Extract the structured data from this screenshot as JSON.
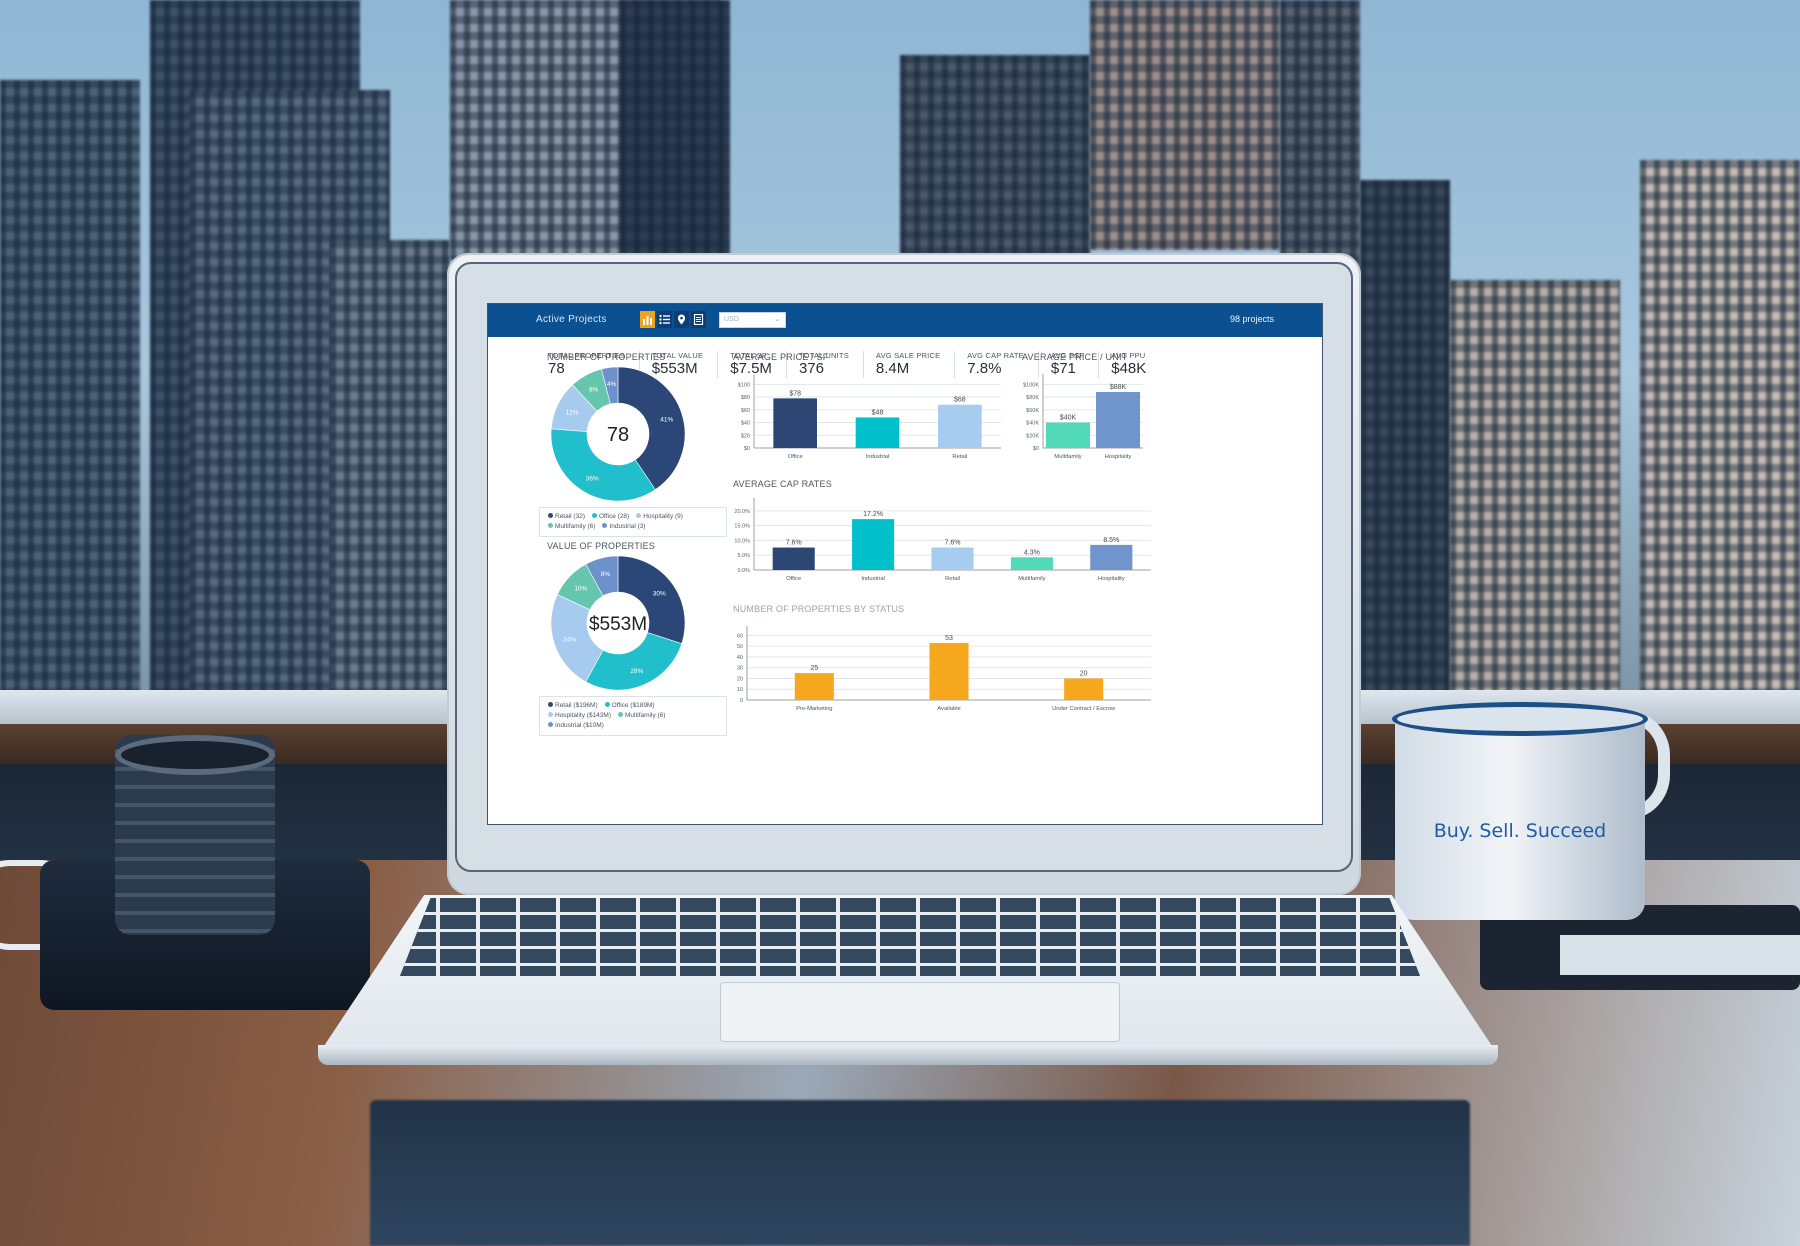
{
  "scene": {
    "mug_text": "Buy. Sell. Succeed"
  },
  "header": {
    "title": "Active Projects",
    "view_icons": [
      {
        "name": "bar-chart-icon",
        "active": true
      },
      {
        "name": "list-icon",
        "active": false
      },
      {
        "name": "map-pin-icon",
        "active": false
      },
      {
        "name": "document-icon",
        "active": false
      }
    ],
    "currency": {
      "value": "USD",
      "options_visible": [
        "USD"
      ]
    },
    "project_count": "98 projects"
  },
  "kpis": [
    {
      "label": "TOTAL PROPERTIES",
      "value": "78"
    },
    {
      "label": "TOTAL VALUE",
      "value": "$553M"
    },
    {
      "label": "TOTAL SF",
      "value": "$7.5M"
    },
    {
      "label": "TOTAL UNITS",
      "value": "376"
    },
    {
      "label": "AVG SALE PRICE",
      "value": "8.4M"
    },
    {
      "label": "AVG CAP RATE",
      "value": "7.8%"
    },
    {
      "label": "AVG PSF",
      "value": "$71"
    },
    {
      "label": "AVG PPU",
      "value": "$48K"
    }
  ],
  "colors": {
    "header_bg": "#0b5191",
    "active_icon": "#f4a21c",
    "retail": "#2b4777",
    "office": "#20bfcb",
    "hospitality": "#a6cbee",
    "multifamily": "#66c6ad",
    "industrial": "#6d91cb",
    "industrial_bar": "#00c0cc",
    "multifamily_bar": "#52d9b7",
    "hospitality_bar": "#6f95cc",
    "status_bar": "#f5a81e"
  },
  "chart_data": [
    {
      "id": "number_of_properties",
      "type": "pie",
      "title": "NUMBER OF PROPERTIES",
      "center_label": "78",
      "slices": [
        {
          "label": "Retail",
          "count": 32,
          "percent": 41,
          "color": "#2b4777"
        },
        {
          "label": "Office",
          "count": 28,
          "percent": 36,
          "color": "#20bfcb"
        },
        {
          "label": "Hospitality",
          "count": 9,
          "percent": 12,
          "color": "#a6cbee"
        },
        {
          "label": "Multifamily",
          "count": 6,
          "percent": 8,
          "color": "#66c6ad"
        },
        {
          "label": "Industrial",
          "count": 3,
          "percent": 4,
          "color": "#6d91cb"
        }
      ],
      "legend": [
        "Retail (32)",
        "Office (28)",
        "Hospitality (9)",
        "Multifamily (6)",
        "Industrial (3)"
      ],
      "legend_position": "bottom"
    },
    {
      "id": "value_of_properties",
      "type": "pie",
      "title": "VALUE OF PROPERTIES",
      "center_label": "$553M",
      "slices": [
        {
          "label": "Retail",
          "value_m": 196,
          "percent": 30,
          "color": "#2b4777"
        },
        {
          "label": "Office",
          "value_m": 189,
          "percent": 28,
          "color": "#20bfcb"
        },
        {
          "label": "Hospitality",
          "value_m": 143,
          "percent": 24,
          "color": "#a6cbee"
        },
        {
          "label": "Multifamily",
          "percent": 10,
          "color": "#66c6ad"
        },
        {
          "label": "Industrial",
          "value_m": 10,
          "percent": 8,
          "color": "#6d91cb"
        }
      ],
      "legend": [
        "Retail ($196M)",
        "Office ($189M)",
        "Hospitality ($143M)",
        "Multifamily (6)",
        "Industrial ($10M)"
      ],
      "legend_position": "bottom"
    },
    {
      "id": "avg_price_sf",
      "type": "bar",
      "title": "AVERAGE PRICE / SF",
      "categories": [
        "Office",
        "Industrial",
        "Retail"
      ],
      "values": [
        78,
        48,
        68
      ],
      "value_labels": [
        "$78",
        "$48",
        "$68"
      ],
      "colors": [
        "#2e4674",
        "#00c0cc",
        "#a6cdf0"
      ],
      "yticks": [
        "$0",
        "$20",
        "$40",
        "$60",
        "$80",
        "$100"
      ],
      "ylim": [
        0,
        110
      ],
      "grid": true
    },
    {
      "id": "avg_price_unit",
      "type": "bar",
      "title": "AVERAGE PRICE / UNIT",
      "categories": [
        "Multifamily",
        "Hospitality"
      ],
      "values": [
        40,
        88
      ],
      "value_labels": [
        "$40K",
        "$88K"
      ],
      "colors": [
        "#52d9b7",
        "#6f95cc"
      ],
      "yticks": [
        "$0",
        "$20K",
        "$40K",
        "$60K",
        "$80K",
        "$100K"
      ],
      "ylim": [
        0,
        110
      ],
      "grid": true
    },
    {
      "id": "avg_cap_rates",
      "type": "bar",
      "title": "AVERAGE CAP RATES",
      "categories": [
        "Office",
        "Industrial",
        "Retail",
        "Multifamily",
        "Hospitality"
      ],
      "values": [
        7.6,
        17.2,
        7.6,
        4.3,
        8.5
      ],
      "value_labels": [
        "7.6%",
        "17.2%",
        "7.6%",
        "4.3%",
        "8.5%"
      ],
      "colors": [
        "#2e4674",
        "#00c0cc",
        "#a6cdf0",
        "#52d9b7",
        "#6f95cc"
      ],
      "yticks": [
        "0.0%",
        "5.0%",
        "10.0%",
        "15.0%",
        "20.0%"
      ],
      "ylim": [
        0,
        23
      ],
      "grid": true
    },
    {
      "id": "properties_by_status",
      "type": "bar",
      "title": "NUMBER OF PROPERTIES BY STATUS",
      "categories": [
        "Pre-Marketing",
        "Available",
        "Under Contract / Escrow"
      ],
      "values": [
        25,
        53,
        20
      ],
      "value_labels": [
        "25",
        "53",
        "20"
      ],
      "colors": [
        "#f5a81e",
        "#f5a81e",
        "#f5a81e"
      ],
      "yticks": [
        "0",
        "10",
        "20",
        "30",
        "40",
        "50",
        "60"
      ],
      "ylim": [
        0,
        65
      ],
      "grid": true
    }
  ]
}
